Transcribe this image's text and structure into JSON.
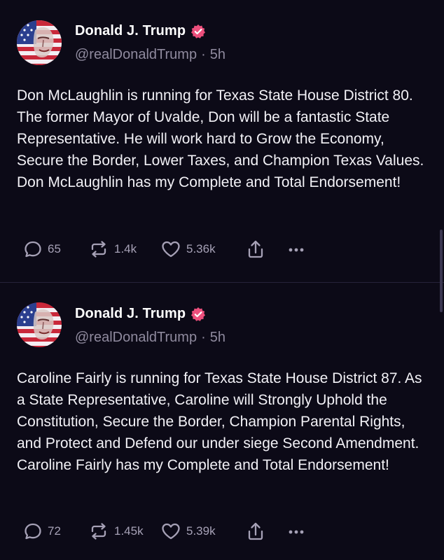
{
  "colors": {
    "background": "#0c0a17",
    "verified": "#ec4f7c",
    "muted": "#8f8a9e",
    "divider": "#26233a"
  },
  "posts": [
    {
      "author": {
        "display_name": "Donald J. Trump",
        "handle": "@realDonaldTrump",
        "separator": "·",
        "time": "5h",
        "avatar": "flag-portrait-avatar",
        "verified_icon": "verified-badge-icon"
      },
      "text": "Don McLaughlin is running for Texas State House District 80. The former Mayor of Uvalde, Don will be a fantastic State Representative. He will work hard to Grow the Economy, Secure the Border, Lower Taxes, and Champion Texas Values. Don McLaughlin has my Complete and Total Endorsement!",
      "actions": {
        "replies": "65",
        "reposts": "1.4k",
        "likes": "5.36k",
        "share_icon": "share-icon",
        "more_icon": "more-icon"
      }
    },
    {
      "author": {
        "display_name": "Donald J. Trump",
        "handle": "@realDonaldTrump",
        "separator": "·",
        "time": "5h",
        "avatar": "flag-portrait-avatar",
        "verified_icon": "verified-badge-icon"
      },
      "text": "Caroline Fairly is running for Texas State House District 87. As a State Representative, Caroline will Strongly Uphold the Constitution, Secure the Border, Champion Parental Rights, and Protect and Defend our under siege Second Amendment. Caroline Fairly has my Complete and Total Endorsement!",
      "actions": {
        "replies": "72",
        "reposts": "1.45k",
        "likes": "5.39k",
        "share_icon": "share-icon",
        "more_icon": "more-icon"
      }
    }
  ]
}
